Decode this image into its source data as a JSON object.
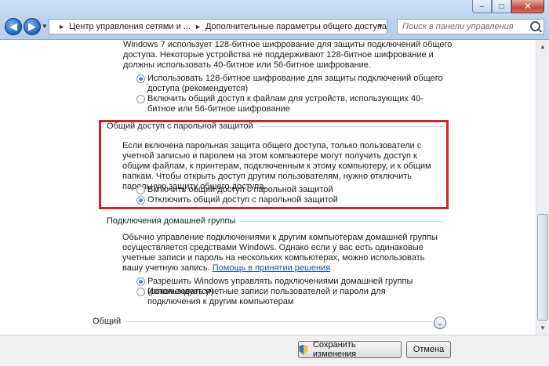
{
  "window": {
    "minimize_glyph": "–",
    "maximize_glyph": "□",
    "close_glyph": "✕"
  },
  "toolbar": {
    "breadcrumbs": [
      "Центр управления сетями и ...",
      "Дополнительные параметры общего доступа"
    ],
    "search_placeholder": "Поиск в панели управления"
  },
  "encryption": {
    "intro": "Windows 7 использует 128-битное шифрование для защиты подключений общего доступа. Некоторые устройства не поддерживают 128-битное шифрование и должны использовать 40-битное или 56-битное шифрование.",
    "options": [
      {
        "label": "Использовать 128-битное шифрование для защиты подключений общего доступа (рекомендуется)",
        "selected": true
      },
      {
        "label": "Включить общий доступ к файлам для устройств, использующих 40-битное или 56-битное шифрование",
        "selected": false
      }
    ]
  },
  "password_sharing": {
    "title": "Общий доступ с парольной защитой",
    "description": "Если включена парольная защита общего доступа, только пользователи с учетной записью и паролем на этом компьютере могут получить доступ к общим файлам, к принтерам, подключенным к этому компьютеру, и к общим папкам. Чтобы открыть доступ другим пользователям, нужно отключить парольную защиту общего доступа.",
    "options": [
      {
        "label": "Включить общий доступ с парольной защитой",
        "selected": false
      },
      {
        "label": "Отключить общий доступ с парольной защитой",
        "selected": true
      }
    ],
    "highlight_color": "#d2202c"
  },
  "homegroup": {
    "title": "Подключения домашней группы",
    "description": "Обычно управление подключениями к другим компьютерам домашней группы осуществляется средствами Windows. Однако если у вас есть одинаковые учетные записи и пароль на нескольких компьютерах, можно использовать вашу учетную запись.",
    "help_link": "Помощь в принятии решения",
    "options": [
      {
        "label": "Разрешить Windows управлять подключениями домашней группы (рекомендуется)",
        "selected": true
      },
      {
        "label": "Использовать учетные записи пользователей и пароли для подключения к другим компьютерам",
        "selected": false
      }
    ]
  },
  "general": {
    "title": "Общий",
    "expand_glyph": "⌄"
  },
  "buttons": {
    "save": "Сохранить изменения",
    "cancel": "Отмена"
  }
}
